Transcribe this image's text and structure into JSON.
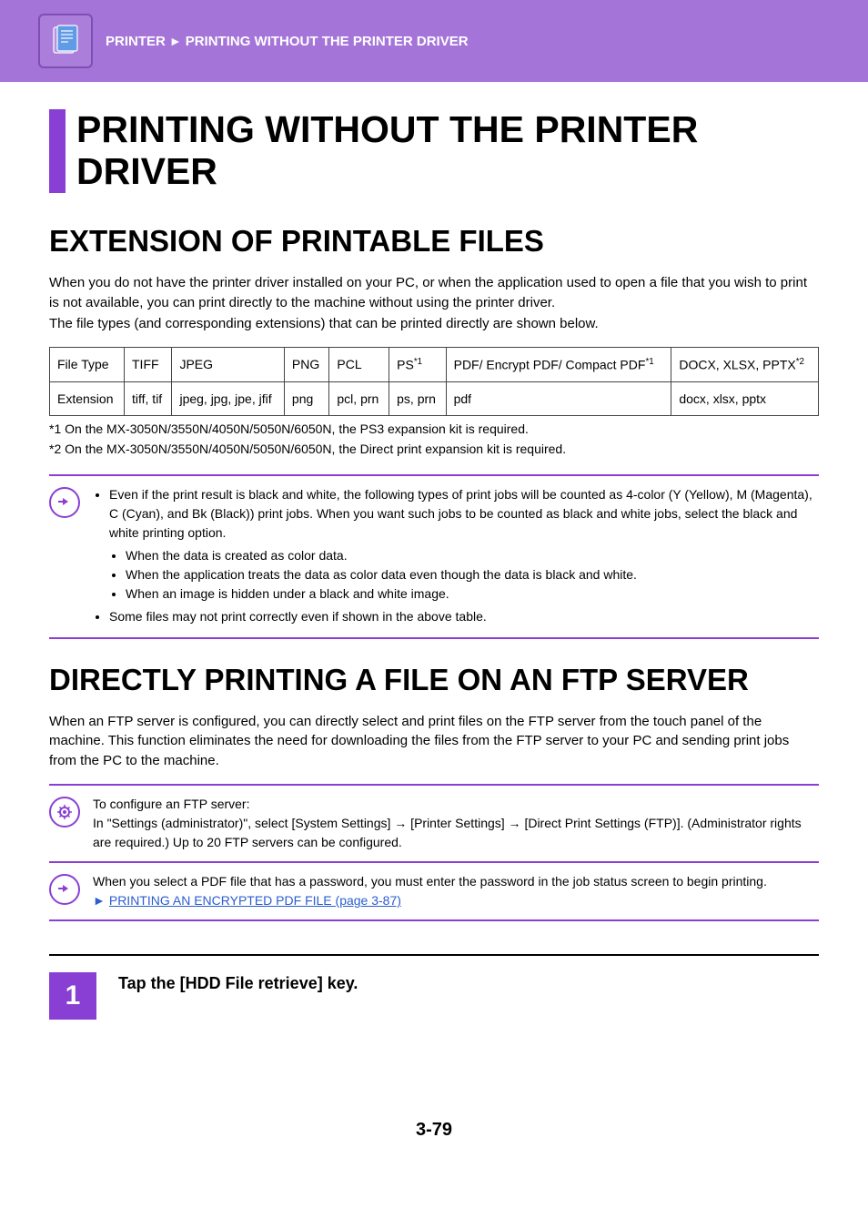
{
  "header": {
    "breadcrumb_root": "PRINTER",
    "breadcrumb_leaf": "PRINTING WITHOUT THE PRINTER DRIVER"
  },
  "title": "PRINTING WITHOUT THE PRINTER DRIVER",
  "section1": {
    "heading": "EXTENSION OF PRINTABLE FILES",
    "para1": "When you do not have the printer driver installed on your PC, or when the application used to open a file that you wish to print is not available, you can print directly to the machine without using the printer driver.",
    "para2": "The file types (and corresponding extensions) that can be printed directly are shown below.",
    "table": {
      "row1": [
        "File Type",
        "TIFF",
        "JPEG",
        "PNG",
        "PCL",
        "PS",
        "PDF/ Encrypt PDF/ Compact PDF",
        "DOCX, XLSX, PPTX"
      ],
      "row1_sup": {
        "5": "*1",
        "6": "*1",
        "7": "*2"
      },
      "row2": [
        "Extension",
        "tiff, tif",
        "jpeg, jpg, jpe, jfif",
        "png",
        "pcl, prn",
        "ps, prn",
        "pdf",
        "docx, xlsx, pptx"
      ]
    },
    "footnote1": "*1 On the MX-3050N/3550N/4050N/5050N/6050N, the PS3 expansion kit is required.",
    "footnote2": "*2 On the MX-3050N/3550N/4050N/5050N/6050N, the Direct print expansion kit is required.",
    "info_bullet1": "Even if the print result is black and white, the following types of print jobs will be counted as 4-color (Y (Yellow), M (Magenta), C (Cyan), and Bk (Black)) print jobs. When you want such jobs to be counted as black and white jobs, select the black and white printing option.",
    "info_sub1": "When the data is created as color data.",
    "info_sub2": "When the application treats the data as color data even though the data is black and white.",
    "info_sub3": "When an image is hidden under a black and white image.",
    "info_bullet2": "Some files may not print correctly even if shown in the above table."
  },
  "section2": {
    "heading": "DIRECTLY PRINTING A FILE ON AN FTP SERVER",
    "para": "When an FTP server is configured, you can directly select and print files on the FTP server from the touch panel of the machine. This function eliminates the need for downloading the files from the FTP server to your PC and sending print jobs from the PC to the machine.",
    "admin_line1": "To configure an FTP server:",
    "admin_line2": "In \"Settings (administrator)\", select [System Settings] → [Printer Settings] → [Direct Print Settings (FTP)].  (Administrator rights are required.) Up to 20 FTP servers can be configured.",
    "note_line": "When you select a PDF file that has a password, you must enter the password in the job status screen to begin printing.",
    "note_link": "PRINTING AN ENCRYPTED PDF FILE (page 3-87)",
    "step1_num": "1",
    "step1_text": "Tap the [HDD File retrieve] key."
  },
  "page_number": "3-79"
}
